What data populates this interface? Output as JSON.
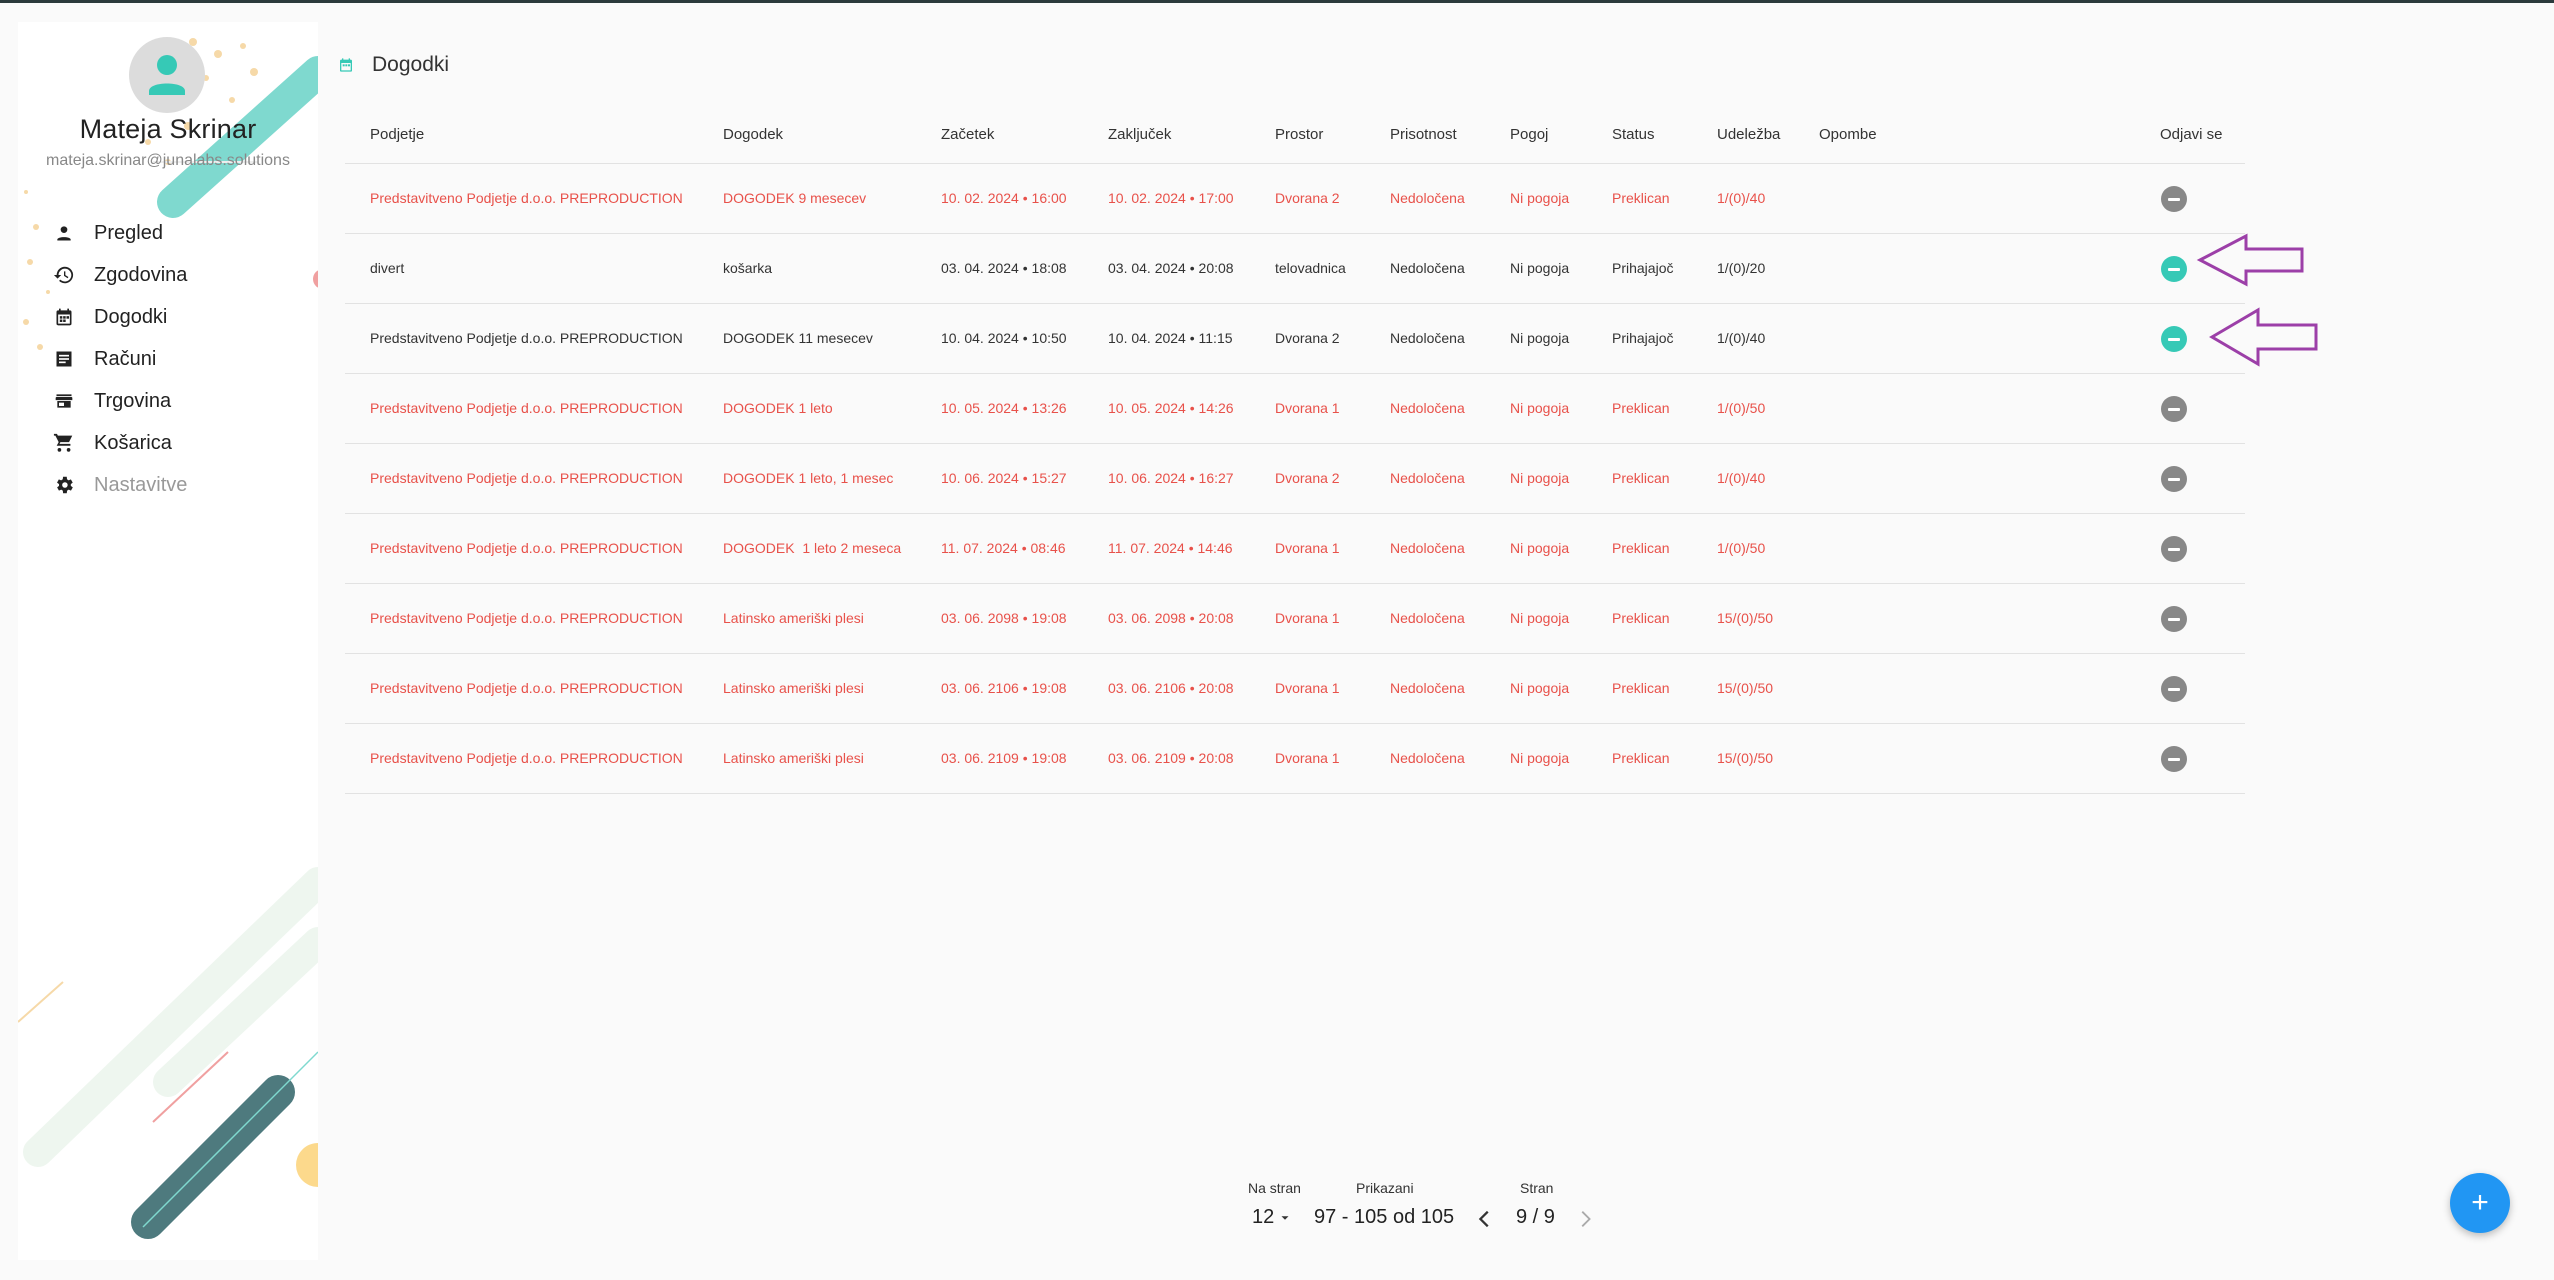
{
  "user": {
    "name": "Mateja Skrinar",
    "email": "mateja.skrinar@junalabs.solutions"
  },
  "nav": [
    {
      "label": "Pregled",
      "icon": "person-icon"
    },
    {
      "label": "Zgodovina",
      "icon": "history-icon"
    },
    {
      "label": "Dogodki",
      "icon": "calendar-icon"
    },
    {
      "label": "Računi",
      "icon": "receipt-icon"
    },
    {
      "label": "Trgovina",
      "icon": "store-icon"
    },
    {
      "label": "Košarica",
      "icon": "cart-icon"
    },
    {
      "label": "Nastavitve",
      "icon": "settings-icon",
      "disabled": true
    }
  ],
  "page": {
    "title": "Dogodki",
    "icon": "calendar-icon"
  },
  "table": {
    "headers": [
      "Podjetje",
      "Dogodek",
      "Začetek",
      "Zaključek",
      "Prostor",
      "Prisotnost",
      "Pogoj",
      "Status",
      "Udeležba",
      "Opombe",
      "Odjavi se"
    ],
    "rows": [
      {
        "company": "Predstavitveno Podjetje d.o.o. PREPRODUCTION",
        "event": "DOGODEK 9 mesecev",
        "start": "10. 02. 2024 • 16:00",
        "end": "10. 02. 2024 • 17:00",
        "room": "Dvorana 2",
        "presence": "Nedoločena",
        "condition": "Ni pogoja",
        "status": "Preklican",
        "attendance": "1/(0)/40",
        "notes": "",
        "cancelled": true
      },
      {
        "company": "divert",
        "event": "košarka",
        "start": "03. 04. 2024 • 18:08",
        "end": "03. 04. 2024 • 20:08",
        "room": "telovadnica",
        "presence": "Nedoločena",
        "condition": "Ni pogoja",
        "status": "Prihajajoč",
        "attendance": "1/(0)/20",
        "notes": "",
        "cancelled": false
      },
      {
        "company": "Predstavitveno Podjetje d.o.o. PREPRODUCTION",
        "event": "DOGODEK 11 mesecev",
        "start": "10. 04. 2024 • 10:50",
        "end": "10. 04. 2024 • 11:15",
        "room": "Dvorana 2",
        "presence": "Nedoločena",
        "condition": "Ni pogoja",
        "status": "Prihajajoč",
        "attendance": "1/(0)/40",
        "notes": "",
        "cancelled": false
      },
      {
        "company": "Predstavitveno Podjetje d.o.o. PREPRODUCTION",
        "event": "DOGODEK 1 leto",
        "start": "10. 05. 2024 • 13:26",
        "end": "10. 05. 2024 • 14:26",
        "room": "Dvorana 1",
        "presence": "Nedoločena",
        "condition": "Ni pogoja",
        "status": "Preklican",
        "attendance": "1/(0)/50",
        "notes": "",
        "cancelled": true
      },
      {
        "company": "Predstavitveno Podjetje d.o.o. PREPRODUCTION",
        "event": "DOGODEK 1 leto, 1 mesec",
        "start": "10. 06. 2024 • 15:27",
        "end": "10. 06. 2024 • 16:27",
        "room": "Dvorana 2",
        "presence": "Nedoločena",
        "condition": "Ni pogoja",
        "status": "Preklican",
        "attendance": "1/(0)/40",
        "notes": "",
        "cancelled": true
      },
      {
        "company": "Predstavitveno Podjetje d.o.o. PREPRODUCTION",
        "event": "DOGODEK  1 leto 2 meseca",
        "start": "11. 07. 2024 • 08:46",
        "end": "11. 07. 2024 • 14:46",
        "room": "Dvorana 1",
        "presence": "Nedoločena",
        "condition": "Ni pogoja",
        "status": "Preklican",
        "attendance": "1/(0)/50",
        "notes": "",
        "cancelled": true
      },
      {
        "company": "Predstavitveno Podjetje d.o.o. PREPRODUCTION",
        "event": "Latinsko ameriški plesi",
        "start": "03. 06. 2098 • 19:08",
        "end": "03. 06. 2098 • 20:08",
        "room": "Dvorana 1",
        "presence": "Nedoločena",
        "condition": "Ni pogoja",
        "status": "Preklican",
        "attendance": "15/(0)/50",
        "notes": "",
        "cancelled": true
      },
      {
        "company": "Predstavitveno Podjetje d.o.o. PREPRODUCTION",
        "event": "Latinsko ameriški plesi",
        "start": "03. 06. 2106 • 19:08",
        "end": "03. 06. 2106 • 20:08",
        "room": "Dvorana 1",
        "presence": "Nedoločena",
        "condition": "Ni pogoja",
        "status": "Preklican",
        "attendance": "15/(0)/50",
        "notes": "",
        "cancelled": true
      },
      {
        "company": "Predstavitveno Podjetje d.o.o. PREPRODUCTION",
        "event": "Latinsko ameriški plesi",
        "start": "03. 06. 2109 • 19:08",
        "end": "03. 06. 2109 • 20:08",
        "room": "Dvorana 1",
        "presence": "Nedoločena",
        "condition": "Ni pogoja",
        "status": "Preklican",
        "attendance": "15/(0)/50",
        "notes": "",
        "cancelled": true
      }
    ]
  },
  "pagination": {
    "per_page_label": "Na stran",
    "per_page_value": "12",
    "shown_label": "Prikazani",
    "shown_value": "97 - 105 od 105",
    "page_label": "Stran",
    "page_value": "9 / 9"
  },
  "fab": {
    "label": "+"
  },
  "colors": {
    "accent": "#36c9b6",
    "cancelled": "#e8514a",
    "fab": "#2196f3",
    "annotation": "#9c3fa8"
  }
}
